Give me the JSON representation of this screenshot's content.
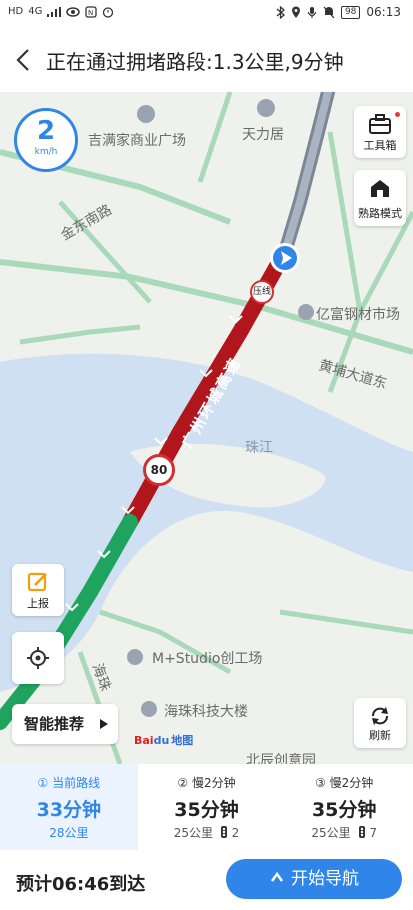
{
  "status_bar": {
    "left_icons": [
      "HD",
      "4G",
      "signal-icon",
      "eye-icon",
      "nfc-icon",
      "alarm-icon"
    ],
    "right_icons": [
      "bluetooth-icon",
      "location-icon",
      "mic-icon",
      "mute-icon"
    ],
    "battery": "98",
    "time": "06:13"
  },
  "header": {
    "title": "正在通过拥堵路段:1.3公里,9分钟"
  },
  "map": {
    "speed_value": "2",
    "speed_unit": "km/h",
    "toolbox_label": "工具箱",
    "familiar_mode_label": "熟路模式",
    "report_label": "上报",
    "refresh_label": "刷新",
    "smart_recommend_label": "智能推荐",
    "labels": {
      "poi_jiman": "吉满家商业广场",
      "poi_tianliju": "天力居",
      "road_jindongnan": "金东南路",
      "poi_yifu": "亿富钢材市场",
      "road_huangpu": "黄埔大道东",
      "river_zhujiang": "珠江",
      "road_haizhu": "海珠",
      "poi_mstudio": "M+Studio创工场",
      "poi_haizhu_tech": "海珠科技大楼",
      "poi_beichen": "北辰创意园",
      "highway_name": "广州环城高速",
      "speed_limit": "80",
      "lane_sign": "压线"
    },
    "baidu_logo_text": "Bai",
    "baidu_logo_du": "du",
    "baidu_logo_map": "地图"
  },
  "routes": [
    {
      "label": "① 当前路线",
      "time": "33分钟",
      "dist": "28公里",
      "lights": ""
    },
    {
      "label": "② 慢2分钟",
      "time": "35分钟",
      "dist": "25公里",
      "lights": "2"
    },
    {
      "label": "③ 慢2分钟",
      "time": "35分钟",
      "dist": "25公里",
      "lights": "7"
    }
  ],
  "footer": {
    "eta": "预计06:46到达",
    "start_label": "开始导航"
  },
  "colors": {
    "accent": "#2f86e8",
    "congestion": "#b0161c",
    "clear": "#1fa460",
    "water": "#cfe0f2"
  }
}
